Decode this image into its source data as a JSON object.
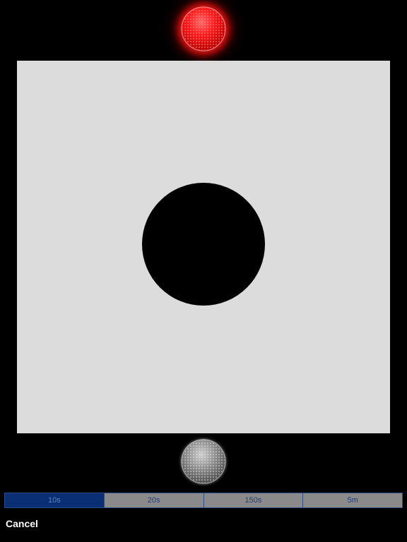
{
  "indicators": {
    "top": {
      "icon": "red-light-icon",
      "state": "on",
      "color": "#ff1414"
    },
    "bottom": {
      "icon": "gray-light-icon",
      "state": "off",
      "color": "#8c8c8c"
    }
  },
  "canvas": {
    "background": "#dcdcdc",
    "target_color": "#000000"
  },
  "duration": {
    "options": [
      "10s",
      "20s",
      "150s",
      "5m"
    ],
    "selected": "10s",
    "selected_color": "#0a2f74",
    "unselected_color": "#8a8a8a"
  },
  "footer": {
    "cancel_label": "Cancel"
  }
}
